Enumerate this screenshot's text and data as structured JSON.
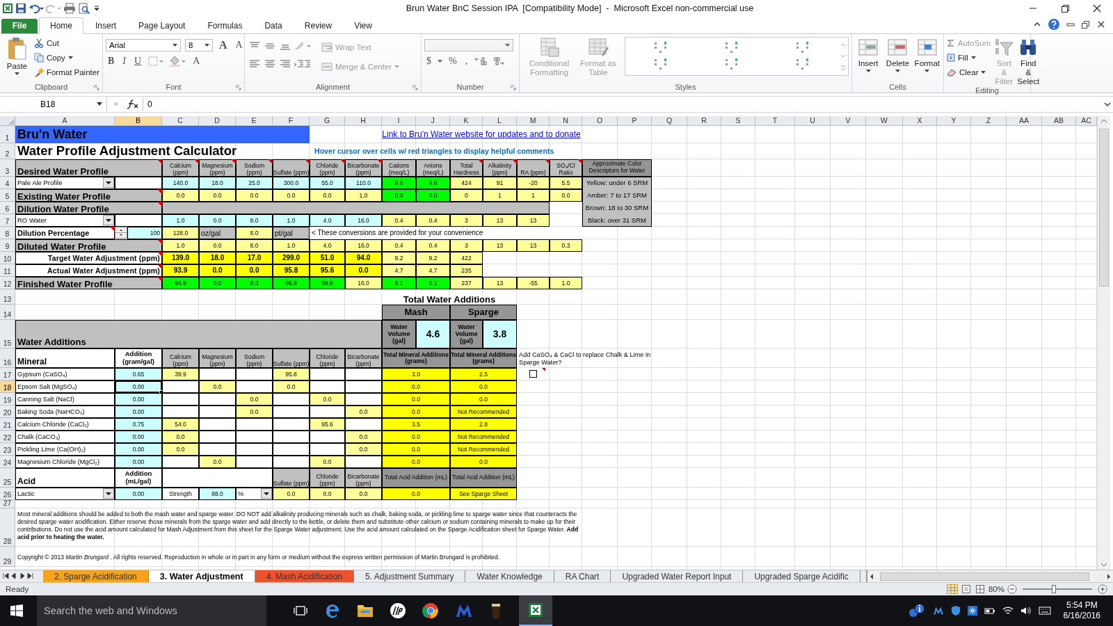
{
  "window": {
    "title": "Brun Water BnC Session IPA  [Compatibility Mode]  -  Microsoft Excel non-commercial use"
  },
  "ribbon": {
    "tabs": [
      {
        "label": "File",
        "kind": "file",
        "selected": false
      },
      {
        "label": "Home",
        "kind": "tab",
        "selected": true
      },
      {
        "label": "Insert",
        "kind": "tab",
        "selected": false
      },
      {
        "label": "Page Layout",
        "kind": "tab",
        "selected": false
      },
      {
        "label": "Formulas",
        "kind": "tab",
        "selected": false
      },
      {
        "label": "Data",
        "kind": "tab",
        "selected": false
      },
      {
        "label": "Review",
        "kind": "tab",
        "selected": false
      },
      {
        "label": "View",
        "kind": "tab",
        "selected": false
      }
    ],
    "clipboard": {
      "title": "Clipboard",
      "paste": "Paste",
      "cut": "Cut",
      "copy": "Copy",
      "format_painter": "Format Painter"
    },
    "font": {
      "title": "Font",
      "family": "Arial",
      "size": "8",
      "grow": "A",
      "shrink": "A",
      "bold": "B",
      "italic": "I",
      "underline": "U",
      "text_color_button": "A"
    },
    "alignment": {
      "title": "Alignment",
      "wrap_text": {
        "label": "Wrap Text",
        "disabled": true
      },
      "merge": {
        "label": "Merge & Center",
        "disabled": true
      }
    },
    "number": {
      "title": "Number",
      "currency": "$",
      "percent": "%",
      "comma": ","
    },
    "styles": {
      "title": "Styles",
      "conditional": {
        "label": "Conditional Formatting",
        "disabled": true
      },
      "table": {
        "label": "Format as Table",
        "disabled": true
      }
    },
    "cells": {
      "title": "Cells",
      "buttons": [
        "Insert",
        "Delete",
        "Format"
      ]
    },
    "editing": {
      "title": "Editing",
      "autosum": {
        "label": "AutoSum",
        "disabled": true
      },
      "fill": "Fill",
      "clear": "Clear",
      "sort": {
        "label": "Sort & Filter",
        "disabled": true
      },
      "find": "Find & Select"
    }
  },
  "formula_bar": {
    "name_box": "B18",
    "value": "0"
  },
  "sheet": {
    "columns": [
      "A",
      "B",
      "C",
      "D",
      "E",
      "F",
      "G",
      "H",
      "I",
      "J",
      "K",
      "L",
      "M",
      "N",
      "O",
      "P",
      "Q",
      "R",
      "S",
      "T",
      "U",
      "V",
      "W",
      "X",
      "Y",
      "Z",
      "AA",
      "AB",
      "AC"
    ],
    "rows": [
      "1",
      "2",
      "3",
      "4",
      "5",
      "6",
      "7",
      "8",
      "9",
      "10",
      "11",
      "12",
      "13",
      "14",
      "15",
      "16",
      "17",
      "18",
      "19",
      "20",
      "21",
      "22",
      "23",
      "24",
      "25",
      "26",
      "27",
      "28",
      "29"
    ]
  },
  "banner": "Bru'n Water",
  "title": "Water Profile Adjustment Calculator",
  "link": "Link to Bru'n Water website for updates and to donate",
  "hint": "Hover cursor over cells w/ red triangles to display helpful comments",
  "profile": {
    "label": "Desired Water Profile",
    "comment": true,
    "headers": [
      {
        "text": "Calcium (ppm)",
        "comment": true
      },
      {
        "text": "Magnesium (ppm)",
        "comment": true
      },
      {
        "text": "Sodium (ppm)",
        "comment": true
      },
      {
        "text": "Sulfate (ppm)",
        "comment": true
      },
      {
        "text": "Chloride (ppm)",
        "comment": true
      },
      {
        "text": "Bicarbonate (ppm)",
        "comment": true
      },
      {
        "text": "Cations (meq/L)",
        "comment": false
      },
      {
        "text": "Anions (meq/L)",
        "comment": false
      },
      {
        "text": "Total Hardness",
        "comment": true
      },
      {
        "text": "Alkalinity (ppm)",
        "comment": true
      },
      {
        "text": "RA (ppm)",
        "comment": true
      },
      {
        "text": "SO₄/Cl Ratio",
        "comment": true
      }
    ],
    "rows": [
      {
        "kind": "select",
        "value": "Pale Ale Profile",
        "cells": [
          {
            "text": "140.0",
            "kind": "input"
          },
          {
            "text": "18.0",
            "kind": "input"
          },
          {
            "text": "25.0",
            "kind": "input"
          },
          {
            "text": "300.0",
            "kind": "input"
          },
          {
            "text": "55.0",
            "kind": "input"
          },
          {
            "text": "110.0",
            "kind": "input"
          },
          {
            "text": "9.6",
            "kind": "ok"
          },
          {
            "text": "9.6",
            "kind": "ok"
          },
          {
            "text": "424",
            "kind": "calc"
          },
          {
            "text": "91",
            "kind": "calc"
          },
          {
            "text": "-20",
            "kind": "calc"
          },
          {
            "text": "5.5",
            "kind": "calc"
          }
        ]
      },
      {
        "kind": "label",
        "label": "Existing Water Profile",
        "comment": true,
        "cells": [
          {
            "text": "0.0",
            "kind": "calc"
          },
          {
            "text": "0.0",
            "kind": "calc"
          },
          {
            "text": "0.0",
            "kind": "calc"
          },
          {
            "text": "0.0",
            "kind": "calc"
          },
          {
            "text": "0.0",
            "kind": "calc"
          },
          {
            "text": "1.0",
            "kind": "calc"
          },
          {
            "text": "0.0",
            "kind": "ok"
          },
          {
            "text": "0.0",
            "kind": "ok"
          },
          {
            "text": "0",
            "kind": "calc"
          },
          {
            "text": "1",
            "kind": "calc"
          },
          {
            "text": "1",
            "kind": "calc"
          },
          {
            "text": "0.0",
            "kind": "calc"
          }
        ]
      },
      {
        "kind": "band",
        "label": "Dilution Water Profile",
        "comment": true
      },
      {
        "kind": "select",
        "value": "RO Water",
        "cells": [
          {
            "text": "1.0",
            "kind": "input"
          },
          {
            "text": "0.0",
            "kind": "input"
          },
          {
            "text": "8.0",
            "kind": "input"
          },
          {
            "text": "1.0",
            "kind": "input"
          },
          {
            "text": "4.0",
            "kind": "input"
          },
          {
            "text": "16.0",
            "kind": "input"
          },
          {
            "text": "0.4",
            "kind": "calc"
          },
          {
            "text": "0.4",
            "kind": "calc"
          },
          {
            "text": "3",
            "kind": "calc"
          },
          {
            "text": "13",
            "kind": "calc"
          },
          {
            "text": "13",
            "kind": "calc"
          }
        ]
      },
      {
        "kind": "percentage",
        "label": "Dilution Percentage",
        "comment": true,
        "value": "100",
        "note": "< These conversions are provided for your convenience",
        "cells": [
          {
            "text": "128.0",
            "kind": "calc"
          },
          {
            "text": "oz/gal",
            "kind": "unit"
          },
          {
            "text": "8.0",
            "kind": "calc"
          },
          {
            "text": "pt/gal",
            "kind": "unit"
          }
        ]
      },
      {
        "kind": "label",
        "label": "Diluted Water Profile",
        "comment": true,
        "cells": [
          {
            "text": "1.0",
            "kind": "calc"
          },
          {
            "text": "0.0",
            "kind": "calc"
          },
          {
            "text": "8.0",
            "kind": "calc"
          },
          {
            "text": "1.0",
            "kind": "calc"
          },
          {
            "text": "4.0",
            "kind": "calc"
          },
          {
            "text": "16.0",
            "kind": "calc"
          },
          {
            "text": "0.4",
            "kind": "calc"
          },
          {
            "text": "0.4",
            "kind": "calc"
          },
          {
            "text": "3",
            "kind": "calc"
          },
          {
            "text": "13",
            "kind": "calc"
          },
          {
            "text": "13",
            "kind": "calc"
          },
          {
            "text": "0.3",
            "kind": "calc"
          }
        ]
      },
      {
        "kind": "adjust",
        "label": "Target Water Adjustment (ppm)",
        "comment": true,
        "cells": [
          {
            "text": "139.0",
            "kind": "result"
          },
          {
            "text": "18.0",
            "kind": "result"
          },
          {
            "text": "17.0",
            "kind": "result"
          },
          {
            "text": "299.0",
            "kind": "result"
          },
          {
            "text": "51.0",
            "kind": "result"
          },
          {
            "text": "94.0",
            "kind": "result"
          },
          {
            "text": "9.2",
            "kind": "calc"
          },
          {
            "text": "9.2",
            "kind": "calc"
          },
          {
            "text": "422",
            "kind": "calc"
          }
        ]
      },
      {
        "kind": "adjust",
        "label": "Actual Water Adjustment (ppm)",
        "comment": true,
        "cells": [
          {
            "text": "93.9",
            "kind": "result"
          },
          {
            "text": "0.0",
            "kind": "result"
          },
          {
            "text": "0.0",
            "kind": "result"
          },
          {
            "text": "95.8",
            "kind": "result"
          },
          {
            "text": "95.6",
            "kind": "result"
          },
          {
            "text": "0.0",
            "kind": "result"
          },
          {
            "text": "4.7",
            "kind": "calc"
          },
          {
            "text": "4.7",
            "kind": "calc"
          },
          {
            "text": "235",
            "kind": "calc"
          }
        ]
      },
      {
        "kind": "label",
        "label": "Finished Water Profile",
        "comment": true,
        "cells": [
          {
            "text": "94.9",
            "kind": "ok"
          },
          {
            "text": "0.0",
            "kind": "ok"
          },
          {
            "text": "8.0",
            "kind": "ok"
          },
          {
            "text": "96.8",
            "kind": "ok"
          },
          {
            "text": "99.6",
            "kind": "ok"
          },
          {
            "text": "16.0",
            "kind": "calc"
          },
          {
            "text": "5.1",
            "kind": "ok"
          },
          {
            "text": "5.1",
            "kind": "ok"
          },
          {
            "text": "237",
            "kind": "calc"
          },
          {
            "text": "13",
            "kind": "calc"
          },
          {
            "text": "-55",
            "kind": "calc"
          },
          {
            "text": "1.0",
            "kind": "calc"
          }
        ]
      }
    ]
  },
  "color_descriptors": {
    "title": "Approximate Color Descriptors for Water",
    "items": [
      "Yellow: under 6 SRM",
      "Amber: 7 to 17 SRM",
      "Brown: 18 to 30 SRM",
      "Black: over 31 SRM"
    ]
  },
  "additions": {
    "title": "Total Water Additions",
    "label": "Water Additions",
    "mineral_heading": "Mineral",
    "addition_heading": "Addition (gram/gal)",
    "ion_headers": [
      "Calcium (ppm)",
      "Magnesium (ppm)",
      "Sodium (ppm)",
      "Sulfate (ppm)",
      "Chloride (ppm)",
      "Bicarbonate (ppm)"
    ],
    "mash": {
      "title": "Mash",
      "volume_label": "Water Volume (gal)",
      "volume": "4.6",
      "total_label": "Total Mineral Additions (grams)",
      "acid_label": "Total Acid Addition (mL)"
    },
    "sparge": {
      "title": "Sparge",
      "volume_label": "Water Volume (gal)",
      "volume": "3.8",
      "total_label": "Total Mineral Additions (grams)",
      "acid_label": "Total Acid Addition (mL)"
    },
    "minerals": [
      {
        "name": "Gypsum (CaSO₄)",
        "addition": "0.65",
        "selected": false,
        "ions": {
          "calcium": "39.9",
          "sulfate": "95.8"
        },
        "mash": "3.0",
        "sparge": "2.5"
      },
      {
        "name": "Epsom Salt (MgSO₄)",
        "addition": "0.00",
        "selected": true,
        "ions": {
          "magnesium": "0.0",
          "sulfate": "0.0"
        },
        "mash": "0.0",
        "sparge": "0.0"
      },
      {
        "name": "Canning Salt (NaCl)",
        "addition": "0.00",
        "selected": false,
        "ions": {
          "sodium": "0.0",
          "chloride": "0.0"
        },
        "mash": "0.0",
        "sparge": "0.0"
      },
      {
        "name": "Baking Soda (NaHCO₃)",
        "addition": "0.00",
        "selected": false,
        "ions": {
          "sodium": "0.0",
          "bicarbonate": "0.0"
        },
        "mash": "0.0",
        "sparge": "Not Recommended"
      },
      {
        "name": "Calcium Chloride (CaCl₂)",
        "addition": "0.75",
        "selected": false,
        "ions": {
          "calcium": "54.0",
          "chloride": "95.6"
        },
        "mash": "3.5",
        "sparge": "2.8"
      },
      {
        "name": "Chalk (CaCO₃)",
        "addition": "0.00",
        "selected": false,
        "ions": {
          "calcium": "0.0",
          "bicarbonate": "0.0"
        },
        "mash": "0.0",
        "sparge": "Not Recommended"
      },
      {
        "name": "Pickling Lime (Ca(OH)₂)",
        "addition": "0.00",
        "selected": false,
        "ions": {
          "calcium": "0.0",
          "bicarbonate": "0.0"
        },
        "mash": "0.0",
        "sparge": "Not Recommended"
      },
      {
        "name": "Magnesium Chloride (MgCl₂)",
        "addition": "0.00",
        "selected": false,
        "ions": {
          "magnesium": "0.0",
          "chloride": "0.0"
        },
        "mash": "0.0",
        "sparge": "0.0"
      }
    ],
    "sparge_option": {
      "text": "Add CaSO₄ & CaCl to replace Chalk & Lime in Sparge Water?",
      "checked": false
    },
    "acid": {
      "heading": "Acid",
      "addition_heading": "Addition (mL/gal)",
      "ion_headers": [
        "Sulfate (ppm)",
        "Chloride (ppm)",
        "Bicarbonate (ppm)"
      ],
      "type": "Lactic",
      "addition": "0.00",
      "strength_label": "Strength",
      "strength": "88.0",
      "unit": "%",
      "ions": [
        "0.0",
        "0.0",
        "0.0"
      ],
      "mash": "0.0",
      "sparge": "See Sparge Sheet"
    }
  },
  "notes": [
    "Most mineral additions should be added to both the mash water and sparge water.  DO NOT add alkalinity producing minerals such as chalk, baking soda, or pickling lime to sparge water since that counteracts the desired sparge water acidification.  Either reserve those minerals from the sparge water and add directly to the kettle, or delete them and substitute other calcium or sodium containing minerals to make up for their contributions.  Do not use the acid amount calculated for Mash Adjustment from this sheet for the Sparge Water adjustment.  Use the acid amount calculated on the Sparge Acidification sheet for Sparge Water.  **Add acid prior to heating the water.**",
    "Copyright © 2013 *Martin Brungard* . All rights reserved. Reproduction in whole or in part in any form or medium without the express written permission of Martin Brungard is prohibited."
  ],
  "sheet_tabs": [
    {
      "label": "2. Sparge Acidification",
      "selected": false,
      "color": "#f7a21b"
    },
    {
      "label": "3. Water Adjustment",
      "selected": true
    },
    {
      "label": "4. Mash Acidification",
      "selected": false,
      "color": "#f0502a"
    },
    {
      "label": "5. Adjustment Summary",
      "selected": false
    },
    {
      "label": "Water Knowledge",
      "selected": false
    },
    {
      "label": "RA Chart",
      "selected": false
    },
    {
      "label": "Upgraded Water Report Input",
      "selected": false
    },
    {
      "label": "Upgraded Sparge Acidific",
      "selected": false
    }
  ],
  "status_bar": {
    "mode": "Ready",
    "zoom": {
      "label": "80%",
      "level": 0.45
    }
  },
  "taskbar": {
    "search": {
      "placeholder": "Search the web and Windows"
    },
    "time": "5:54 PM",
    "date": "6/16/2016"
  }
}
